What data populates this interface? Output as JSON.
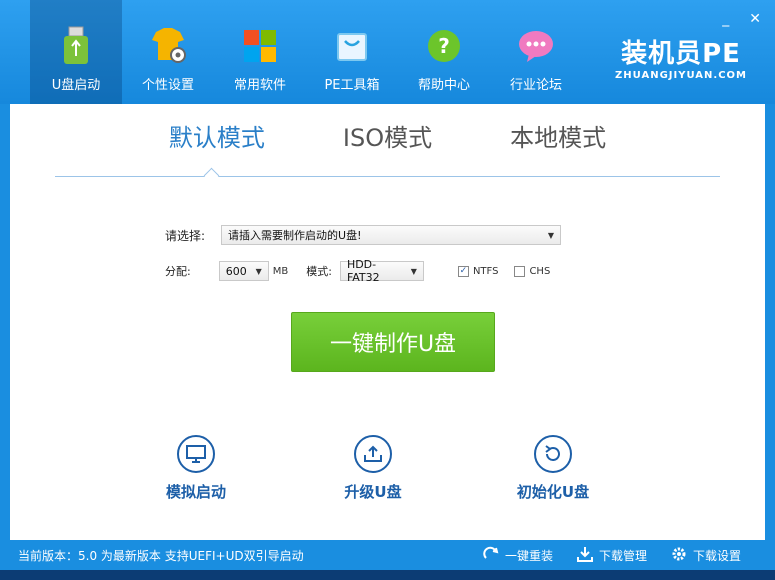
{
  "window": {
    "minimize": "_",
    "close": "✕"
  },
  "nav": {
    "items": [
      {
        "label": "U盘启动",
        "icon": "usb-icon"
      },
      {
        "label": "个性设置",
        "icon": "shirt-gear-icon"
      },
      {
        "label": "常用软件",
        "icon": "windows-icon"
      },
      {
        "label": "PE工具箱",
        "icon": "toolbox-icon"
      },
      {
        "label": "帮助中心",
        "icon": "question-icon"
      },
      {
        "label": "行业论坛",
        "icon": "chat-icon"
      }
    ],
    "active_index": 0
  },
  "brand": {
    "title": "装机员PE",
    "subtitle": "ZHUANGJIYUAN.COM"
  },
  "modes": {
    "tabs": [
      "默认模式",
      "ISO模式",
      "本地模式"
    ],
    "active_index": 0
  },
  "form": {
    "select_label": "请选择:",
    "select_value": "请插入需要制作启动的U盘!",
    "alloc_label": "分配:",
    "alloc_value": "600",
    "alloc_unit": "MB",
    "mode_label": "模式:",
    "mode_value": "HDD-FAT32",
    "ntfs_label": "NTFS",
    "ntfs_checked": true,
    "chs_label": "CHS",
    "chs_checked": false
  },
  "main_button": "一键制作U盘",
  "actions": [
    {
      "label": "模拟启动",
      "icon": "monitor-icon"
    },
    {
      "label": "升级U盘",
      "icon": "upload-icon"
    },
    {
      "label": "初始化U盘",
      "icon": "refresh-icon"
    }
  ],
  "footer": {
    "status": "当前版本：5.0 为最新版本 支持UEFI+UD双引导启动",
    "buttons": [
      {
        "label": "一键重装",
        "icon": "reinstall-icon"
      },
      {
        "label": "下载管理",
        "icon": "download-icon"
      },
      {
        "label": "下载设置",
        "icon": "settings-gear-icon"
      }
    ]
  },
  "colors": {
    "accent": "#1a8ee0",
    "button_green": "#6cc52b",
    "action_blue": "#1d5fa8"
  }
}
